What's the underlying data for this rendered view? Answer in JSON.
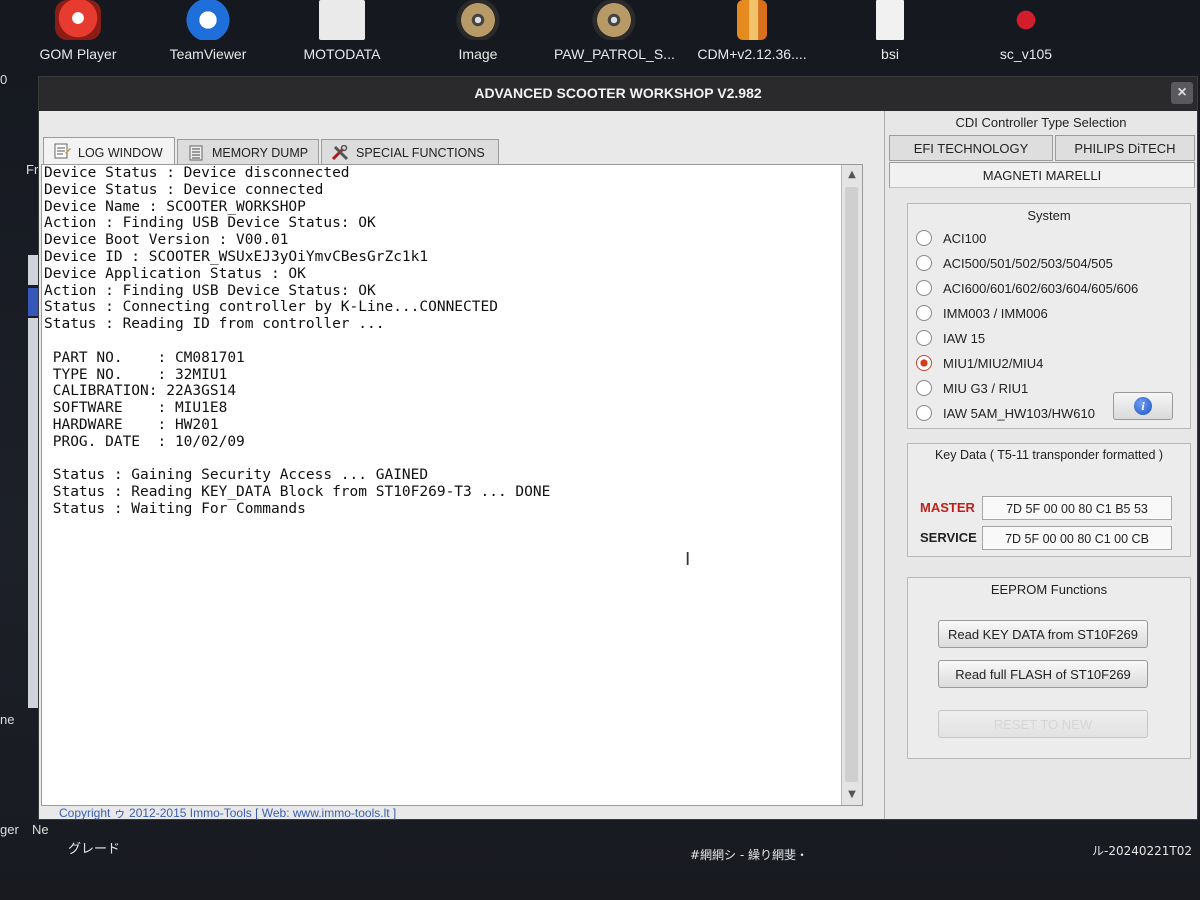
{
  "desktop": {
    "icons": [
      {
        "label": "GOM Player",
        "icon": "gom-player-icon"
      },
      {
        "label": "TeamViewer",
        "icon": "teamviewer-icon"
      },
      {
        "label": "MOTODATA",
        "icon": "motodata-icon"
      },
      {
        "label": "Image",
        "icon": "disc-image-icon"
      },
      {
        "label": "PAW_PATROL_S...",
        "icon": "disc-image-icon"
      },
      {
        "label": "CDM+v2.12.36....",
        "icon": "archive-folder-icon"
      },
      {
        "label": "bsi",
        "icon": "document-file-icon"
      },
      {
        "label": "sc_v105",
        "icon": "app-icon"
      }
    ],
    "left_fragments": [
      "0",
      "Fr",
      "ne",
      "ger",
      "Ne"
    ],
    "bottom_texts": [
      "グレード",
      "#網網シ - 繰り網斐・",
      "ル-20240221T02"
    ]
  },
  "window": {
    "title": "ADVANCED SCOOTER WORKSHOP  V2.982",
    "close": "×",
    "tabs": [
      {
        "label": "LOG WINDOW",
        "icon": "log-icon"
      },
      {
        "label": "MEMORY DUMP",
        "icon": "memory-icon"
      },
      {
        "label": "SPECIAL FUNCTIONS",
        "icon": "tools-icon"
      }
    ],
    "log_lines": [
      "Device Status : Device disconnected",
      "Device Status : Device connected",
      "Device Name : SCOOTER_WORKSHOP",
      "Action : Finding USB Device Status: OK",
      "Device Boot Version : V00.01",
      "Device ID : SCOOTER_WSUxEJ3yOiYmvCBesGrZc1k1",
      "Device Application Status : OK",
      "Action : Finding USB Device Status: OK",
      "Status : Connecting controller by K-Line...CONNECTED",
      "Status : Reading ID from controller ...",
      "",
      " PART NO.    : CM081701",
      " TYPE NO.    : 32MIU1",
      " CALIBRATION: 22A3GS14",
      " SOFTWARE    : MIU1E8",
      " HARDWARE    : HW201",
      " PROG. DATE  : 10/02/09",
      "",
      " Status : Gaining Security Access ... GAINED",
      " Status : Reading KEY_DATA Block from ST10F269-T3 ... DONE",
      " Status : Waiting For Commands"
    ],
    "copyright": "Copyright ゥ 2012-2015 Immo-Tools [ Web: www.immo-tools.lt ]"
  },
  "right_panel": {
    "header": "CDI Controller Type Selection",
    "tabs": [
      "EFI TECHNOLOGY",
      "PHILIPS DiTECH"
    ],
    "subtab": "MAGNETI MARELLI",
    "system": {
      "title": "System",
      "options": [
        {
          "label": "ACI100",
          "checked": false
        },
        {
          "label": "ACI500/501/502/503/504/505",
          "checked": false
        },
        {
          "label": "ACI600/601/602/603/604/605/606",
          "checked": false
        },
        {
          "label": "IMM003 / IMM006",
          "checked": false
        },
        {
          "label": "IAW 15",
          "checked": false
        },
        {
          "label": "MIU1/MIU2/MIU4",
          "checked": true
        },
        {
          "label": "MIU G3 / RIU1",
          "checked": false
        },
        {
          "label": "IAW 5AM_HW103/HW610",
          "checked": false
        }
      ],
      "info_button": "i"
    },
    "key_data": {
      "title": "Key Data ( T5-11 transponder formatted )",
      "master_label": "MASTER",
      "master_value": "7D 5F 00 00 80 C1 B5 53",
      "service_label": "SERVICE",
      "service_value": "7D 5F 00 00 80 C1 00 CB",
      "master_color": "#c0201a",
      "service_color": "#222222"
    },
    "eeprom": {
      "title": "EEPROM Functions",
      "buttons": [
        "Read KEY DATA from ST10F269",
        "Read full FLASH of ST10F269",
        "RESET TO NEW"
      ]
    }
  }
}
